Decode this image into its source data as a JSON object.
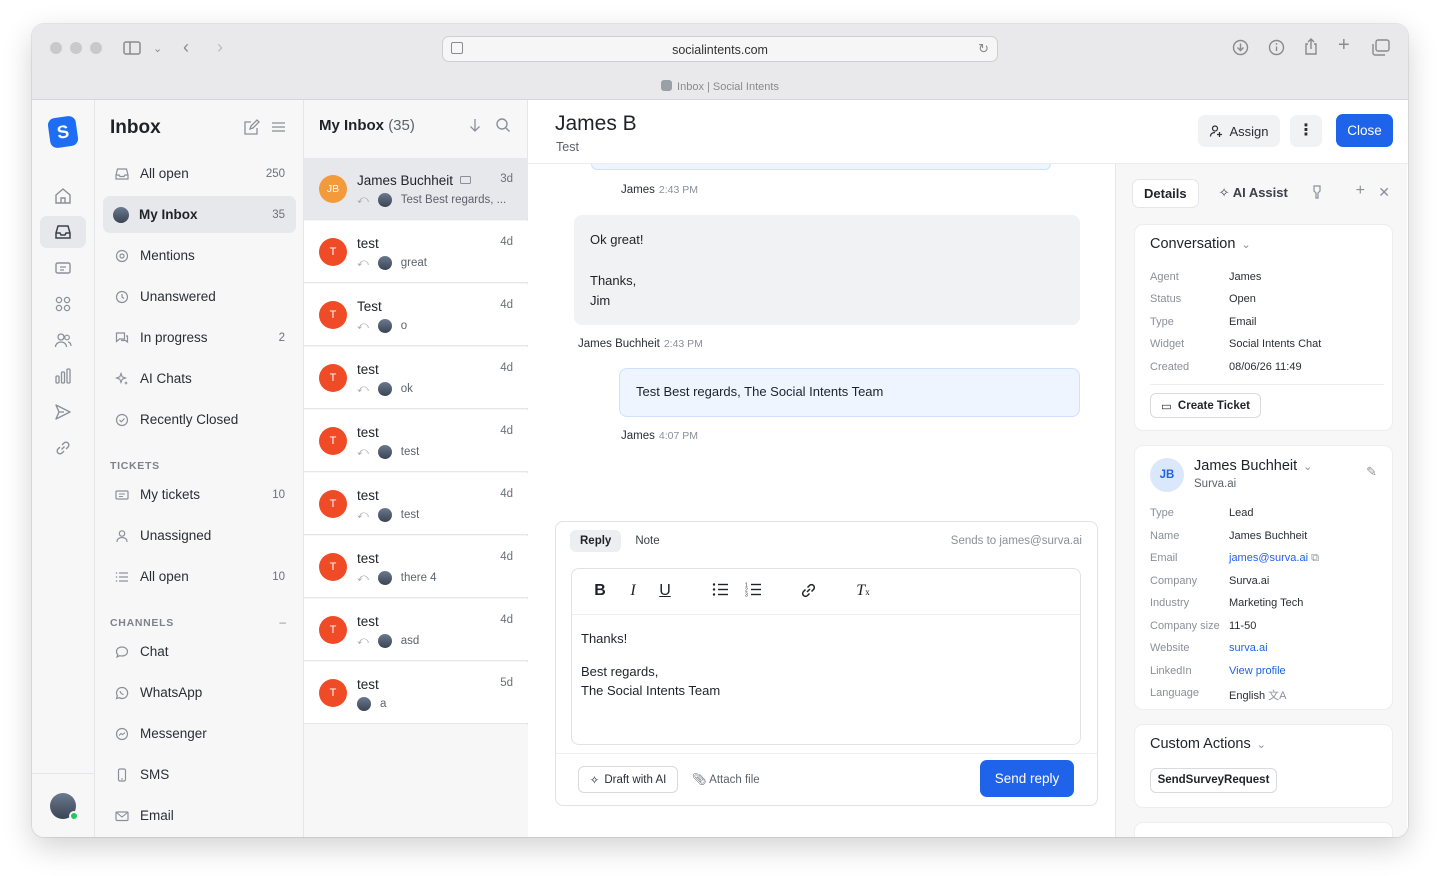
{
  "browser": {
    "url": "socialintents.com",
    "tab_title": "Inbox | Social Intents"
  },
  "sidebar": {
    "title": "Inbox",
    "items": [
      {
        "label": "All open",
        "count": "250"
      },
      {
        "label": "My Inbox",
        "count": "35"
      },
      {
        "label": "Mentions",
        "count": ""
      },
      {
        "label": "Unanswered",
        "count": ""
      },
      {
        "label": "In progress",
        "count": "2"
      },
      {
        "label": "AI Chats",
        "count": ""
      },
      {
        "label": "Recently Closed",
        "count": ""
      }
    ],
    "tickets_label": "TICKETS",
    "tickets": [
      {
        "label": "My tickets",
        "count": "10"
      },
      {
        "label": "Unassigned",
        "count": ""
      },
      {
        "label": "All open",
        "count": "10"
      }
    ],
    "channels_label": "CHANNELS",
    "channels_collapse": "–",
    "channels": [
      {
        "label": "Chat"
      },
      {
        "label": "WhatsApp"
      },
      {
        "label": "Messenger"
      },
      {
        "label": "SMS"
      },
      {
        "label": "Email"
      }
    ]
  },
  "list": {
    "title": "My Inbox",
    "count": "(35)",
    "conversations": [
      {
        "initials": "JB",
        "name": "James Buchheit",
        "time": "3d",
        "preview": "Test Best regards, ..."
      },
      {
        "initials": "T",
        "name": "test",
        "time": "4d",
        "preview": "great"
      },
      {
        "initials": "T",
        "name": "Test",
        "time": "4d",
        "preview": "o"
      },
      {
        "initials": "T",
        "name": "test",
        "time": "4d",
        "preview": "ok"
      },
      {
        "initials": "T",
        "name": "test",
        "time": "4d",
        "preview": "test"
      },
      {
        "initials": "T",
        "name": "test",
        "time": "4d",
        "preview": "test"
      },
      {
        "initials": "T",
        "name": "test",
        "time": "4d",
        "preview": "there 4"
      },
      {
        "initials": "T",
        "name": "test",
        "time": "4d",
        "preview": "asd"
      },
      {
        "initials": "T",
        "name": "test",
        "time": "5d",
        "preview": "a"
      }
    ]
  },
  "conversation": {
    "title": "James B",
    "subtitle": "Test",
    "assign_label": "Assign",
    "more_label": "⋮",
    "close_label": "Close",
    "messages": [
      {
        "author": "James",
        "time": "2:43 PM"
      },
      {
        "body": [
          "Ok great!",
          "",
          "Thanks,",
          "Jim"
        ],
        "author": "James Buchheit",
        "time": "2:43 PM"
      },
      {
        "body": [
          "Test Best regards, The Social Intents Team"
        ],
        "author": "James",
        "time": "4:07 PM"
      }
    ]
  },
  "composer": {
    "tab_reply": "Reply",
    "tab_note": "Note",
    "sends_to": "Sends to james@surva.ai",
    "body_lines": [
      "Thanks!",
      "",
      "Best regards,",
      "The Social Intents Team"
    ],
    "draft_label": "Draft with AI",
    "attach_label": "Attach file",
    "send_label": "Send reply"
  },
  "details": {
    "tab_details": "Details",
    "tab_ai": "AI Assist",
    "conversation_card": {
      "title": "Conversation",
      "rows": [
        {
          "label": "Agent",
          "value": "James"
        },
        {
          "label": "Status",
          "value": "Open"
        },
        {
          "label": "Type",
          "value": "Email"
        },
        {
          "label": "Widget",
          "value": "Social Intents Chat"
        },
        {
          "label": "Created",
          "value": "08/06/26 11:49"
        }
      ],
      "create_ticket_label": "Create Ticket"
    },
    "contact_card": {
      "initials": "JB",
      "name": "James Buchheit",
      "company": "Surva.ai",
      "rows": [
        {
          "label": "Type",
          "value": "Lead"
        },
        {
          "label": "Name",
          "value": "James Buchheit"
        },
        {
          "label": "Email",
          "value": "james@surva.ai"
        },
        {
          "label": "Company",
          "value": "Surva.ai"
        },
        {
          "label": "Industry",
          "value": "Marketing Tech"
        },
        {
          "label": "Company size",
          "value": "11-50"
        },
        {
          "label": "Website",
          "value": "surva.ai"
        },
        {
          "label": "LinkedIn",
          "value": "View profile"
        },
        {
          "label": "Language",
          "value": "English"
        }
      ]
    },
    "actions_card": {
      "title": "Custom Actions",
      "button_label": "SendSurveyRequest"
    }
  },
  "colors": {
    "accent": "#1e63e9",
    "avatar_orange": "#ef4b26",
    "sidebar_bg": "#f7f7f8"
  }
}
